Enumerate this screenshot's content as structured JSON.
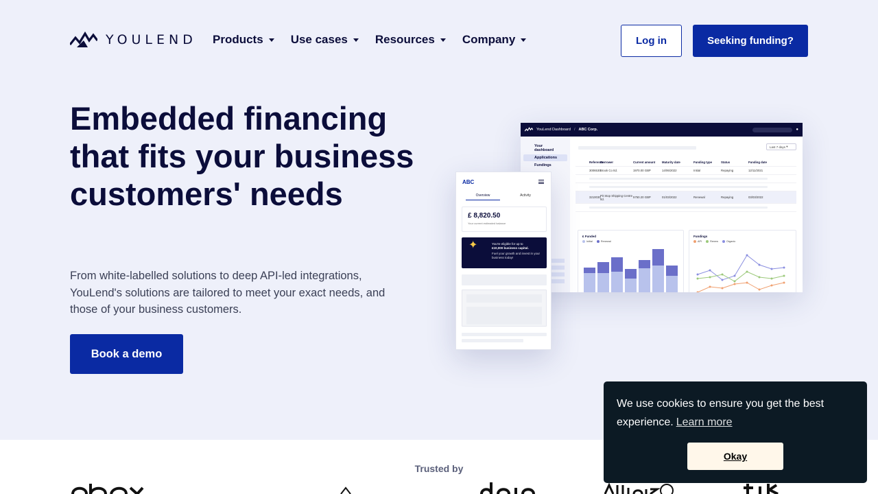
{
  "brand": {
    "name": "YOULEND"
  },
  "nav": {
    "items": [
      {
        "label": "Products"
      },
      {
        "label": "Use cases"
      },
      {
        "label": "Resources"
      },
      {
        "label": "Company"
      }
    ],
    "login_label": "Log in",
    "funding_label": "Seeking funding?"
  },
  "hero": {
    "title": "Embedded financing that fits your business customers' needs",
    "subtitle": "From white-labelled solutions to deep API-led integrations, YouLend's solutions are tailored to meet your exact needs, and those of your business customers.",
    "cta_label": "Book a demo"
  },
  "dashboard": {
    "app_title": "YouLend Dashboard",
    "sep": "/",
    "company": "ABC Corp.",
    "sidebar": [
      "Your dashboard",
      "Applications",
      "Fundings"
    ],
    "filter": "Last 7 days",
    "table": {
      "headers": [
        "Reference",
        "Borrower",
        "Current amount",
        "Maturity date",
        "Funding type",
        "Status",
        "Funding date"
      ],
      "rows": [
        [
          "3006530",
          "Brook Co Itd.",
          "1970.00 GBP",
          "14/06/2022",
          "Initial",
          "Repaying",
          "12/11/2021"
        ],
        [
          "3210030",
          "Pit Stop Shipping Centre Itd.",
          "5750.20 GBP",
          "01/03/2022",
          "Renewal",
          "Repaying",
          "03/03/2022"
        ]
      ]
    },
    "chart_funded": {
      "title": "£ Funded",
      "legend": [
        "Initial",
        "Renewal"
      ]
    },
    "chart_fundings": {
      "title": "Fundings",
      "legend": [
        "API",
        "Renew",
        "Organic"
      ]
    }
  },
  "phone": {
    "brand": "ABC",
    "tabs": [
      "Overview",
      "Activity"
    ],
    "balance": "£ 8,820.50",
    "balance_caption": "Your current estimated balance",
    "promo_line1": "You're eligible for up to",
    "promo_amount": "£10,000 business capital.",
    "promo_line2": "Fuel your growth and invest in your business today!"
  },
  "trusted": {
    "label": "Trusted by"
  },
  "cookie": {
    "message": "We use cookies to ensure you get the best experience.",
    "link": "Learn more",
    "button": "Okay"
  },
  "colors": {
    "primary": "#0a2aa3",
    "dark": "#0b0d3a",
    "hero_bg": "#eef0fa",
    "cookie_bg": "#0c1a24"
  }
}
